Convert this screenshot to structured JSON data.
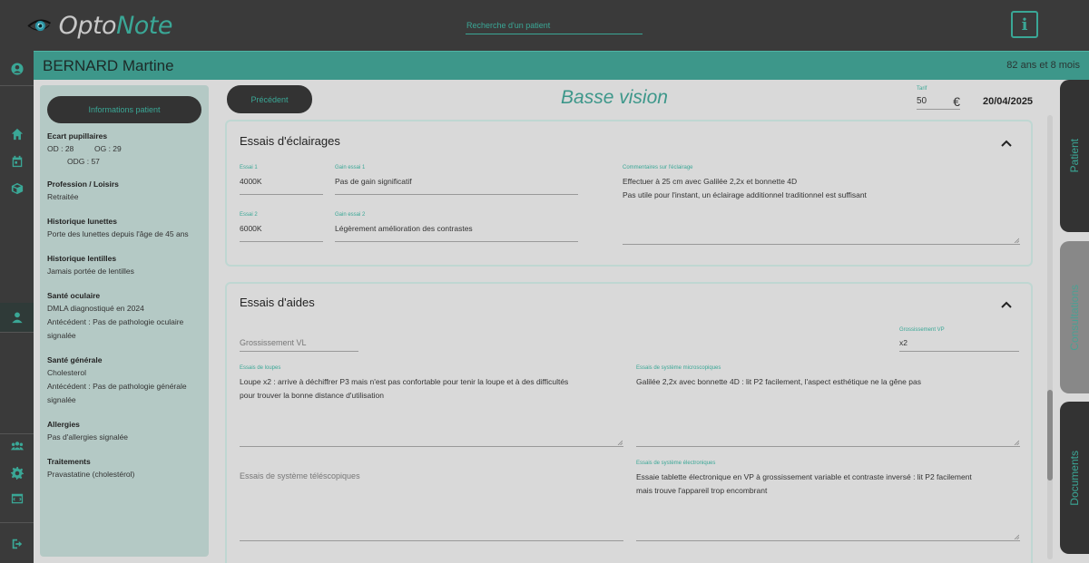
{
  "app": {
    "logo_part1": "Opto",
    "logo_part2": "Note"
  },
  "search": {
    "placeholder": "Recherche d'un patient"
  },
  "info_button": {
    "label": "i"
  },
  "patient": {
    "name": "BERNARD Martine",
    "age": "82 ans et 8 mois"
  },
  "sidebar_info": {
    "button_label": "Informations patient",
    "ecart": {
      "label": "Ecart pupillaires",
      "od": "OD : 28",
      "og": "OG : 29",
      "odg": "ODG : 57"
    },
    "blocks": [
      {
        "label": "Profession / Loisirs",
        "lines": [
          "Retraitée"
        ]
      },
      {
        "label": "Historique lunettes",
        "lines": [
          "Porte des lunettes depuis l'âge de 45 ans"
        ]
      },
      {
        "label": "Historique lentilles",
        "lines": [
          "Jamais portée de lentilles"
        ]
      },
      {
        "label": "Santé oculaire",
        "lines": [
          "DMLA diagnostiqué en 2024",
          "Antécédent : Pas de pathologie oculaire",
          "signalée"
        ]
      },
      {
        "label": "Santé générale",
        "lines": [
          "Cholesterol",
          "Antécédent : Pas de pathologie générale",
          "signalée"
        ]
      },
      {
        "label": "Allergies",
        "lines": [
          "Pas d'allergies signalée"
        ]
      },
      {
        "label": "Traitements",
        "lines": [
          "Pravastatine (cholestérol)"
        ]
      }
    ]
  },
  "toolbar": {
    "prev_label": "Précédent",
    "title": "Basse vision",
    "tarif_label": "Tarif",
    "tarif_value": "50",
    "currency": "€",
    "date": "20/04/2025"
  },
  "eclairages": {
    "title": "Essais d'éclairages",
    "essai1_label": "Essai 1",
    "essai1_value": "4000K",
    "gain1_label": "Gain essai 1",
    "gain1_value": "Pas de gain significatif",
    "essai2_label": "Essai 2",
    "essai2_value": "6000K",
    "gain2_label": "Gain essai 2",
    "gain2_value": "Légèrement amélioration des contrastes",
    "comment_label": "Commentaires sur l'éclairage",
    "comment_line1": "Effectuer à 25 cm avec Galilée 2,2x et bonnette 4D",
    "comment_line2": "Pas utile pour l'instant, un éclairage additionnel traditionnel est suffisant"
  },
  "aides": {
    "title": "Essais d'aides",
    "grossissement_vl_placeholder": "Grossissement VL",
    "grossissement_vp_label": "Grossissement VP",
    "grossissement_vp_value": "x2",
    "loupes_label": "Essais de loupes",
    "loupes_line1": "Loupe x2 : arrive à déchiffrer P3 mais n'est pas confortable pour tenir la loupe et à des difficultés",
    "loupes_line2": "pour trouver la bonne distance d'utilisation",
    "micro_label": "Essais de système microscopiques",
    "micro_value": "Galilée 2,2x avec bonnette 4D : lit P2 facilement, l'aspect esthétique ne la gêne pas",
    "tele_placeholder": "Essais de système téléscopiques",
    "electro_label": "Essais de système électroniques",
    "electro_line1": "Essaie tablette électronique en VP à grossissement variable et contraste inversé : lit P2 facilement",
    "electro_line2": "mais trouve l'appareil trop encombrant"
  },
  "right_tabs": {
    "patient": "Patient",
    "consultations": "Consultations",
    "documents": "Documents"
  },
  "colors": {
    "accent": "#3aa796",
    "header": "#3d978a",
    "dark": "#3a3a3a"
  }
}
